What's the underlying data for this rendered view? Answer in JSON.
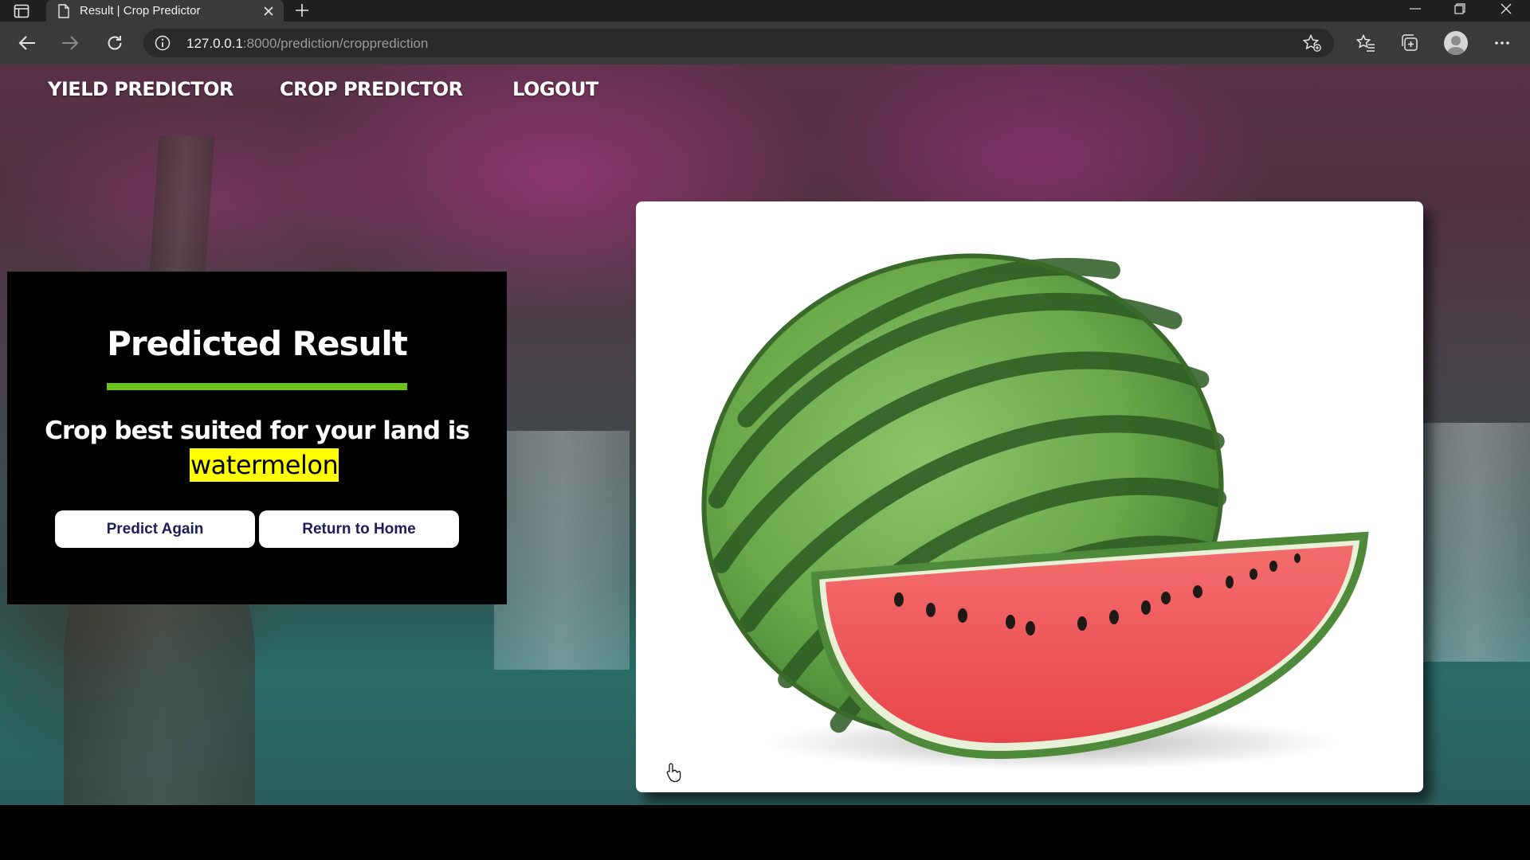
{
  "browser": {
    "tab_title": "Result | Crop Predictor",
    "url_host": "127.0.0.1",
    "url_path": ":8000/prediction/cropprediction"
  },
  "nav": {
    "links": [
      "YIELD PREDICTOR",
      "CROP PREDICTOR",
      "LOGOUT"
    ]
  },
  "result": {
    "title": "Predicted Result",
    "message": "Crop best suited for your land is",
    "crop": "watermelon",
    "predict_again_label": "Predict Again",
    "return_home_label": "Return to Home"
  },
  "image": {
    "icon": "watermelon-image"
  },
  "colors": {
    "accent_bar": "#6bc21a",
    "highlight": "#ffff00",
    "button_text": "#1e1d5a"
  }
}
